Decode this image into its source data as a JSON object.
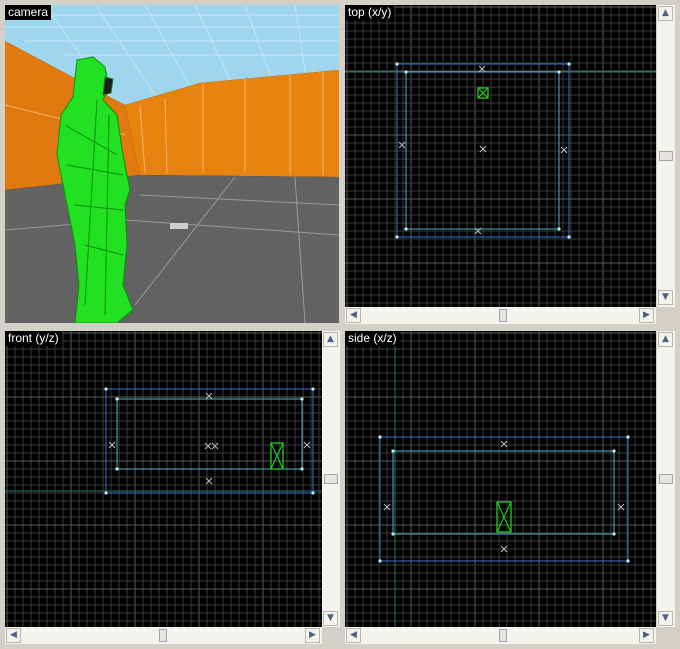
{
  "views": {
    "camera": {
      "label": "camera"
    },
    "top": {
      "label": "top (x/y)"
    },
    "front": {
      "label": "front (y/z)"
    },
    "side": {
      "label": "side (x/z)"
    }
  },
  "icons": {
    "scroll_up": "up-arrow-icon",
    "scroll_down": "down-arrow-icon",
    "scroll_left": "left-arrow-icon",
    "scroll_right": "right-arrow-icon"
  },
  "colors": {
    "grid_fine": "#3a3a3a",
    "grid_major": "#5a5a5a",
    "brush_outer": "#3f6fd0",
    "brush_inner": "#55b0c8",
    "entity": "#22dd22",
    "wall_orange": "#e07a10",
    "sky": "#8ecde8",
    "floor": "#5e5e5e"
  }
}
